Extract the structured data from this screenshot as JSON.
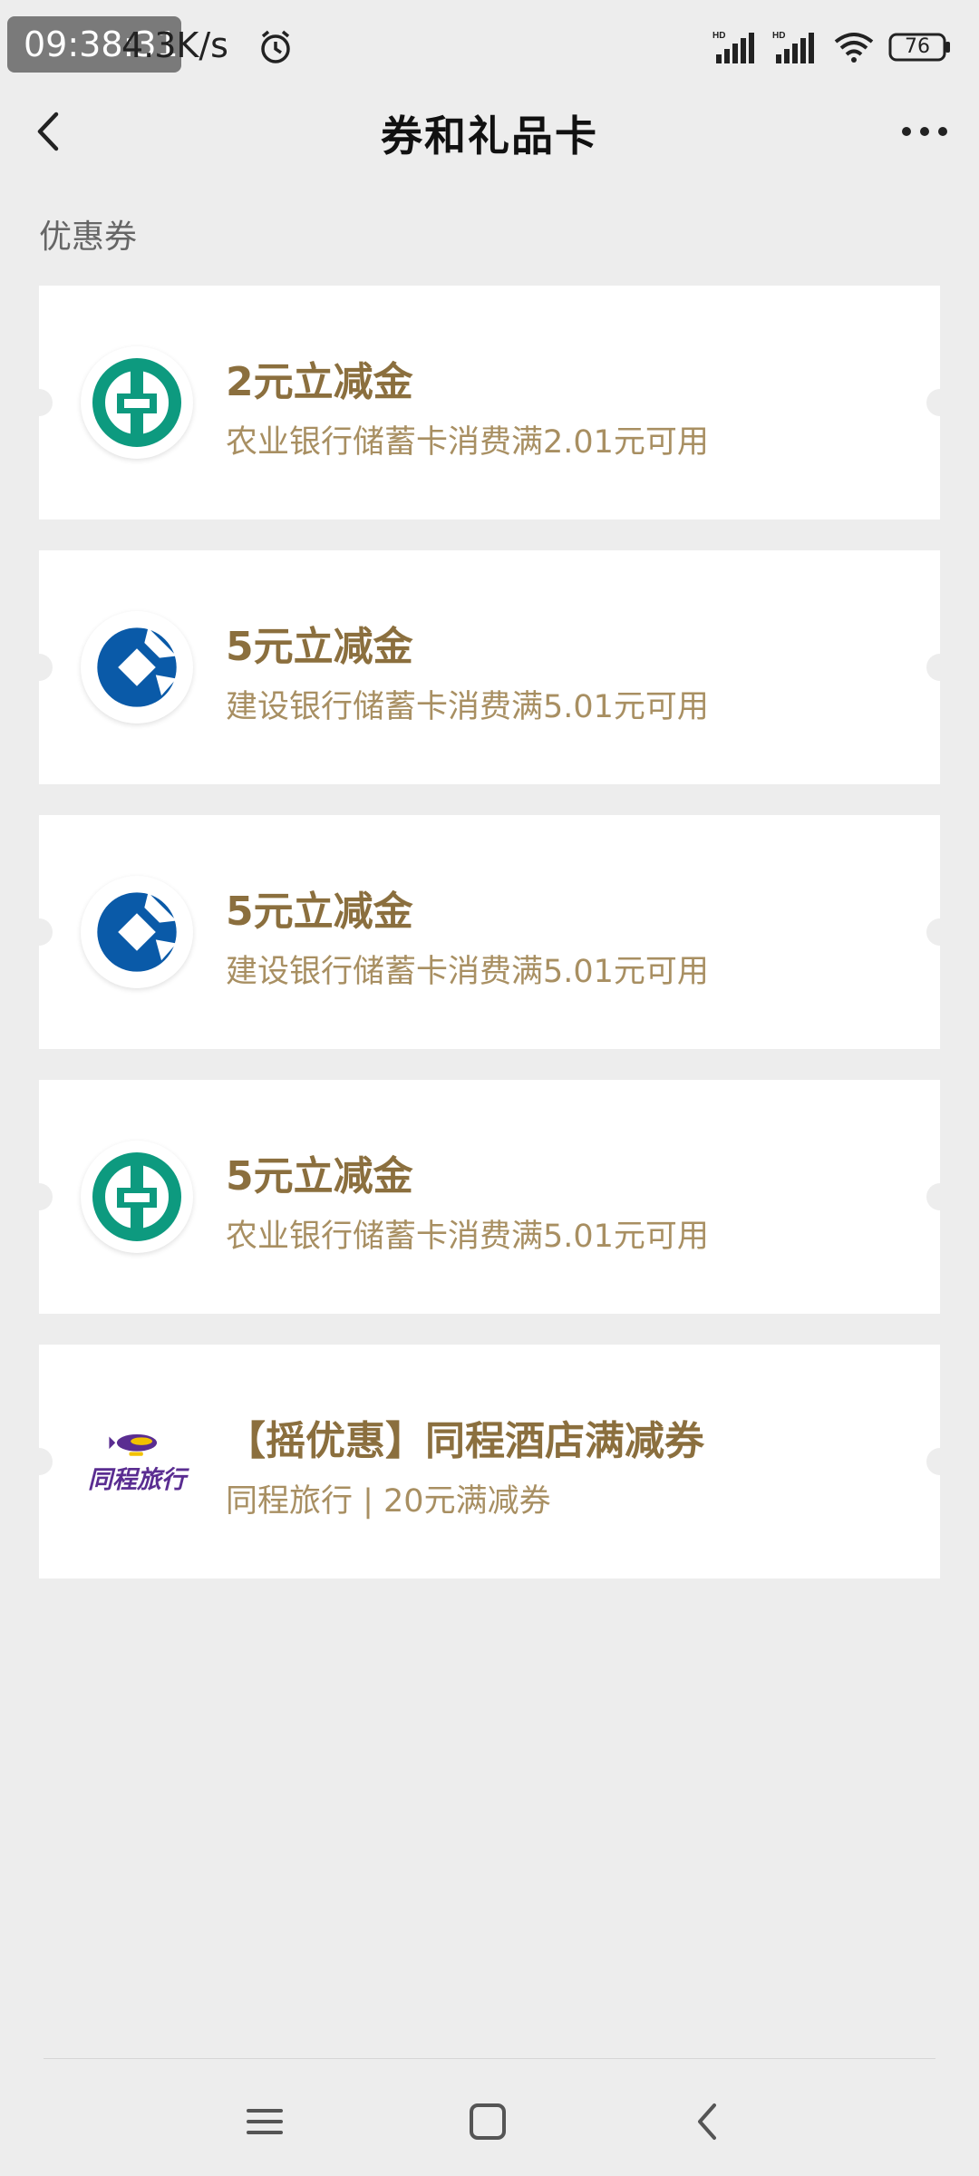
{
  "status_bar": {
    "time": "09:38:31",
    "net_speed": "4.3K/s",
    "battery": "76"
  },
  "header": {
    "title": "券和礼品卡"
  },
  "section_title": "优惠券",
  "coupons": [
    {
      "title": "2元立减金",
      "subtitle": "农业银行储蓄卡消费满2.01元可用",
      "logo": "abc-bank-icon"
    },
    {
      "title": "5元立减金",
      "subtitle": "建设银行储蓄卡消费满5.01元可用",
      "logo": "ccb-bank-icon"
    },
    {
      "title": "5元立减金",
      "subtitle": "建设银行储蓄卡消费满5.01元可用",
      "logo": "ccb-bank-icon"
    },
    {
      "title": "5元立减金",
      "subtitle": "农业银行储蓄卡消费满5.01元可用",
      "logo": "abc-bank-icon"
    },
    {
      "title": "【摇优惠】同程酒店满减券",
      "subtitle": "同程旅行 | 20元满减券",
      "logo": "tongcheng-icon",
      "logo_text": "同程旅行"
    }
  ],
  "colors": {
    "background": "#ededed",
    "coupon_title": "#8b6f3e",
    "coupon_subtitle": "#a88f62",
    "abc_green": "#0d9a7f",
    "ccb_blue": "#0a5aa8",
    "tongcheng_purple": "#5a2d91"
  }
}
